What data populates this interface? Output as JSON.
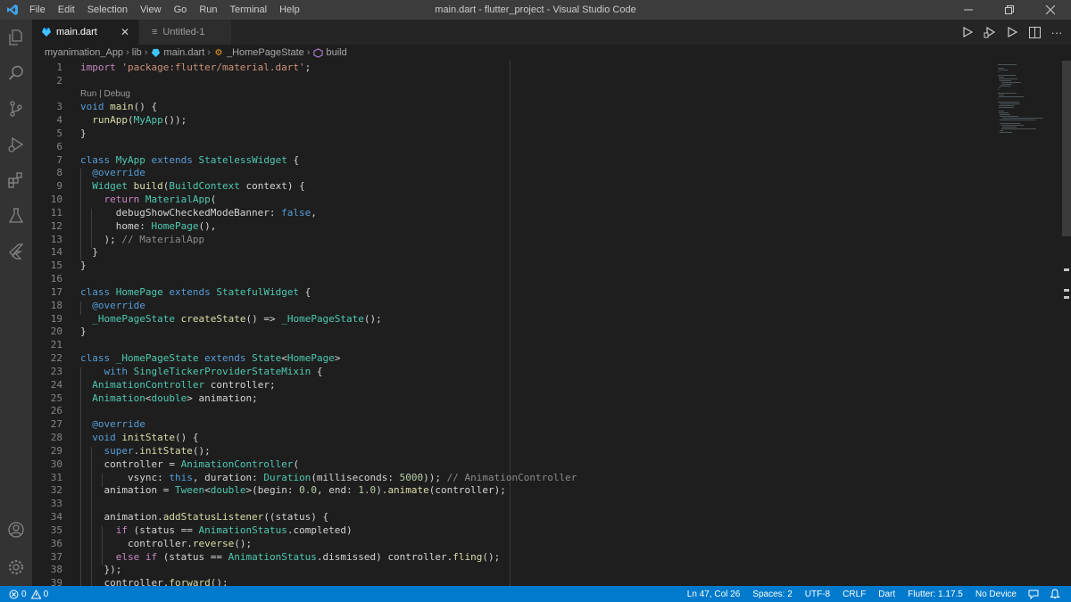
{
  "window": {
    "title": "main.dart - flutter_project - Visual Studio Code",
    "menu": [
      "File",
      "Edit",
      "Selection",
      "View",
      "Go",
      "Run",
      "Terminal",
      "Help"
    ],
    "controls": [
      "minimize-icon",
      "restore-icon",
      "close-icon"
    ]
  },
  "activity_bar": {
    "icons": [
      "explorer-icon",
      "search-icon",
      "source-control-icon",
      "run-debug-icon",
      "extensions-icon",
      "testing-flask-icon",
      "flutter-icon"
    ],
    "bottom_icons": [
      "account-icon",
      "settings-gear-icon"
    ]
  },
  "tabs": [
    {
      "label": "main.dart",
      "active": true,
      "icon": "dart-file-icon"
    },
    {
      "label": "Untitled-1",
      "active": false,
      "icon": "text-file-icon"
    }
  ],
  "editor_actions": [
    "run-icon",
    "debug-icon",
    "run-file-icon",
    "split-editor-icon",
    "more-actions-icon"
  ],
  "breadcrumb": [
    "myanimation_App",
    "lib",
    "main.dart",
    "_HomePageState",
    "build"
  ],
  "codelens": "Run | Debug",
  "code_lines": [
    {
      "n": "1",
      "t": [
        [
          "kwc",
          "import "
        ],
        [
          "str",
          "'package:flutter/material.dart'"
        ],
        [
          "p",
          ";"
        ]
      ]
    },
    {
      "n": "2",
      "t": []
    },
    {
      "n": "3",
      "t": [
        [
          "kw",
          "void "
        ],
        [
          "fn",
          "main"
        ],
        [
          "p",
          "() {"
        ]
      ]
    },
    {
      "n": "4",
      "t": [
        [
          "p",
          "  "
        ],
        [
          "fn",
          "runApp"
        ],
        [
          "p",
          "("
        ],
        [
          "ty",
          "MyApp"
        ],
        [
          "p",
          "());"
        ]
      ]
    },
    {
      "n": "5",
      "t": [
        [
          "p",
          "}"
        ]
      ]
    },
    {
      "n": "6",
      "t": []
    },
    {
      "n": "7",
      "t": [
        [
          "kw",
          "class "
        ],
        [
          "ty",
          "MyApp "
        ],
        [
          "kw",
          "extends "
        ],
        [
          "ty",
          "StatelessWidget"
        ],
        [
          "p",
          " {"
        ]
      ]
    },
    {
      "n": "8",
      "t": [
        [
          "p",
          "  "
        ],
        [
          "kw",
          "@override"
        ]
      ]
    },
    {
      "n": "9",
      "t": [
        [
          "p",
          "  "
        ],
        [
          "ty",
          "Widget "
        ],
        [
          "fn",
          "build"
        ],
        [
          "p",
          "("
        ],
        [
          "ty",
          "BuildContext"
        ],
        [
          "p",
          " context) {"
        ]
      ]
    },
    {
      "n": "10",
      "t": [
        [
          "p",
          "    "
        ],
        [
          "kwc",
          "return "
        ],
        [
          "ty",
          "MaterialApp"
        ],
        [
          "p",
          "("
        ]
      ]
    },
    {
      "n": "11",
      "t": [
        [
          "p",
          "      debugShowCheckedModeBanner: "
        ],
        [
          "kw",
          "false"
        ],
        [
          "p",
          ","
        ]
      ]
    },
    {
      "n": "12",
      "t": [
        [
          "p",
          "      home: "
        ],
        [
          "ty",
          "HomePage"
        ],
        [
          "p",
          "(),"
        ]
      ]
    },
    {
      "n": "13",
      "t": [
        [
          "p",
          "    ); "
        ],
        [
          "cmg",
          "// MaterialApp"
        ]
      ]
    },
    {
      "n": "14",
      "t": [
        [
          "p",
          "  }"
        ]
      ]
    },
    {
      "n": "15",
      "t": [
        [
          "p",
          "}"
        ]
      ]
    },
    {
      "n": "16",
      "t": []
    },
    {
      "n": "17",
      "t": [
        [
          "kw",
          "class "
        ],
        [
          "ty",
          "HomePage "
        ],
        [
          "kw",
          "extends "
        ],
        [
          "ty",
          "StatefulWidget"
        ],
        [
          "p",
          " {"
        ]
      ]
    },
    {
      "n": "18",
      "t": [
        [
          "p",
          "  "
        ],
        [
          "kw",
          "@override"
        ]
      ]
    },
    {
      "n": "19",
      "t": [
        [
          "p",
          "  "
        ],
        [
          "ty",
          "_HomePageState "
        ],
        [
          "fn",
          "createState"
        ],
        [
          "p",
          "() => "
        ],
        [
          "ty",
          "_HomePageState"
        ],
        [
          "p",
          "();"
        ]
      ]
    },
    {
      "n": "20",
      "t": [
        [
          "p",
          "}"
        ]
      ]
    },
    {
      "n": "21",
      "t": []
    },
    {
      "n": "22",
      "t": [
        [
          "kw",
          "class "
        ],
        [
          "ty",
          "_HomePageState "
        ],
        [
          "kw",
          "extends "
        ],
        [
          "ty",
          "State"
        ],
        [
          "p",
          "<"
        ],
        [
          "ty",
          "HomePage"
        ],
        [
          "p",
          ">"
        ]
      ]
    },
    {
      "n": "23",
      "t": [
        [
          "p",
          "    "
        ],
        [
          "kw",
          "with "
        ],
        [
          "ty",
          "SingleTickerProviderStateMixin"
        ],
        [
          "p",
          " {"
        ]
      ]
    },
    {
      "n": "24",
      "t": [
        [
          "p",
          "  "
        ],
        [
          "ty",
          "AnimationController"
        ],
        [
          "p",
          " controller;"
        ]
      ]
    },
    {
      "n": "25",
      "t": [
        [
          "p",
          "  "
        ],
        [
          "ty",
          "Animation"
        ],
        [
          "p",
          "<"
        ],
        [
          "ty",
          "double"
        ],
        [
          "p",
          "> animation;"
        ]
      ]
    },
    {
      "n": "26",
      "t": []
    },
    {
      "n": "27",
      "t": [
        [
          "p",
          "  "
        ],
        [
          "kw",
          "@override"
        ]
      ]
    },
    {
      "n": "28",
      "t": [
        [
          "p",
          "  "
        ],
        [
          "kw",
          "void "
        ],
        [
          "fn",
          "initState"
        ],
        [
          "p",
          "() {"
        ]
      ]
    },
    {
      "n": "29",
      "t": [
        [
          "p",
          "    "
        ],
        [
          "kw",
          "super"
        ],
        [
          "p",
          "."
        ],
        [
          "fn",
          "initState"
        ],
        [
          "p",
          "();"
        ]
      ]
    },
    {
      "n": "30",
      "t": [
        [
          "p",
          "    controller = "
        ],
        [
          "ty",
          "AnimationController"
        ],
        [
          "p",
          "("
        ]
      ]
    },
    {
      "n": "31",
      "t": [
        [
          "p",
          "        vsync: "
        ],
        [
          "kw",
          "this"
        ],
        [
          "p",
          ", duration: "
        ],
        [
          "ty",
          "Duration"
        ],
        [
          "p",
          "(milliseconds: "
        ],
        [
          "num",
          "5000"
        ],
        [
          "p",
          ")); "
        ],
        [
          "cmg",
          "// AnimationController"
        ]
      ]
    },
    {
      "n": "32",
      "t": [
        [
          "p",
          "    animation = "
        ],
        [
          "ty",
          "Tween"
        ],
        [
          "p",
          "<"
        ],
        [
          "ty",
          "double"
        ],
        [
          "p",
          ">(begin: "
        ],
        [
          "num",
          "0.0"
        ],
        [
          "p",
          ", end: "
        ],
        [
          "num",
          "1.0"
        ],
        [
          "p",
          ")."
        ],
        [
          "fn",
          "animate"
        ],
        [
          "p",
          "(controller);"
        ]
      ]
    },
    {
      "n": "33",
      "t": []
    },
    {
      "n": "34",
      "t": [
        [
          "p",
          "    animation."
        ],
        [
          "fn",
          "addStatusListener"
        ],
        [
          "p",
          "((status) {"
        ]
      ]
    },
    {
      "n": "35",
      "t": [
        [
          "p",
          "      "
        ],
        [
          "kwc",
          "if "
        ],
        [
          "p",
          "(status == "
        ],
        [
          "ty",
          "AnimationStatus"
        ],
        [
          "p",
          ".completed)"
        ]
      ]
    },
    {
      "n": "36",
      "t": [
        [
          "p",
          "        controller."
        ],
        [
          "fn",
          "reverse"
        ],
        [
          "p",
          "();"
        ]
      ]
    },
    {
      "n": "37",
      "t": [
        [
          "p",
          "      "
        ],
        [
          "kwc",
          "else if "
        ],
        [
          "p",
          "(status == "
        ],
        [
          "ty",
          "AnimationStatus"
        ],
        [
          "p",
          ".dismissed) controller."
        ],
        [
          "fn",
          "fling"
        ],
        [
          "p",
          "();"
        ]
      ]
    },
    {
      "n": "38",
      "t": [
        [
          "p",
          "    });"
        ]
      ]
    },
    {
      "n": "39",
      "t": [
        [
          "p",
          "    controller."
        ],
        [
          "fn",
          "forward"
        ],
        [
          "p",
          "();"
        ]
      ]
    }
  ],
  "status_bar": {
    "errors": "0",
    "warnings": "0",
    "cursor": "Ln 47, Col 26",
    "spaces": "Spaces: 2",
    "encoding": "UTF-8",
    "eol": "CRLF",
    "language": "Dart",
    "flutter": "Flutter: 1.17.5",
    "device": "No Device",
    "icons": [
      "error-icon",
      "warning-icon",
      "feedback-icon",
      "notifications-bell-icon"
    ]
  }
}
